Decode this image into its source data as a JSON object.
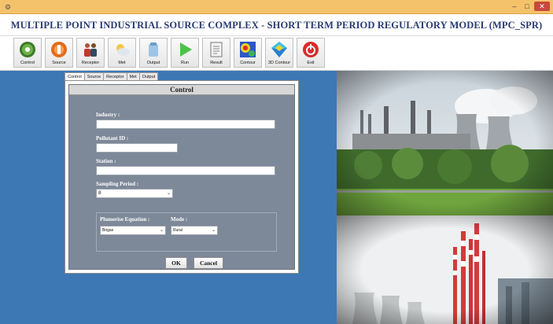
{
  "window": {
    "icon": "app-icon",
    "minimize_glyph": "–",
    "maximize_glyph": "□",
    "close_glyph": "✕"
  },
  "app_title": "MULTIPLE POINT INDUSTRIAL SOURCE COMPLEX - SHORT TERM PERIOD REGULATORY MODEL (MPC_SPR)",
  "toolbar": {
    "items": [
      {
        "label": "Control",
        "icon": "gear-icon"
      },
      {
        "label": "Source",
        "icon": "source-icon"
      },
      {
        "label": "Receptor",
        "icon": "people-icon"
      },
      {
        "label": "Met",
        "icon": "weather-icon"
      },
      {
        "label": "Output",
        "icon": "output-icon"
      },
      {
        "label": "Run",
        "icon": "play-icon"
      },
      {
        "label": "Result",
        "icon": "document-icon"
      },
      {
        "label": "Contour",
        "icon": "contour-map-icon"
      },
      {
        "label": "3D Contour",
        "icon": "3d-contour-icon"
      },
      {
        "label": "Exit",
        "icon": "power-icon"
      }
    ]
  },
  "tabs": [
    {
      "label": "Control",
      "active": true
    },
    {
      "label": "Source",
      "active": false
    },
    {
      "label": "Receptor",
      "active": false
    },
    {
      "label": "Met",
      "active": false
    },
    {
      "label": "Output",
      "active": false
    }
  ],
  "control_panel": {
    "heading": "Control",
    "industry_label": "Industry :",
    "industry_value": "",
    "pollutant_label": "Pollutant ID :",
    "pollutant_value": "",
    "station_label": "Station :",
    "station_value": "",
    "sampling_label": "Sampling Period :",
    "sampling_value": "8",
    "plumerise_label": "Plumerise Equation :",
    "plumerise_value": "Brigas",
    "mode_label": "Mode :",
    "mode_value": "Rural",
    "ok_label": "OK",
    "cancel_label": "Cancel"
  },
  "colors": {
    "workspace_blue": "#3d78b4",
    "titlebar": "#f4c26a",
    "title_text": "#2a3b73",
    "panel_gray": "#7d8898"
  }
}
